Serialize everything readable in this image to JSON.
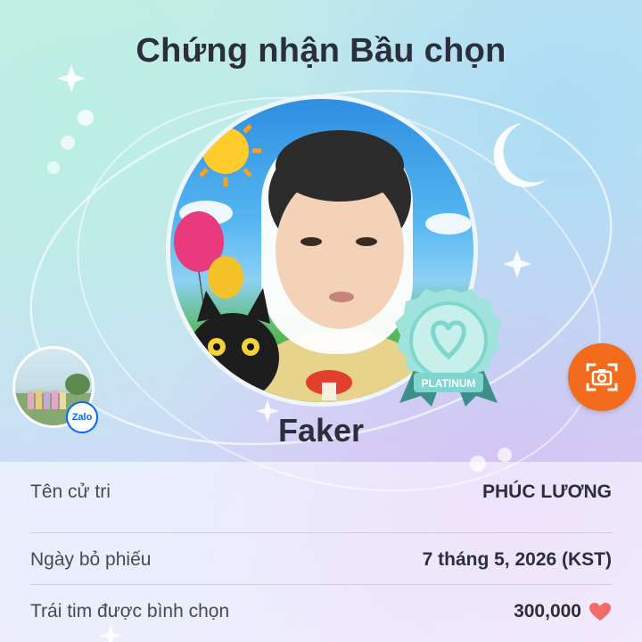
{
  "header": {
    "title": "Chứng nhận Bầu chọn"
  },
  "candidate": {
    "nickname": "Faker",
    "tier_badge": "PLATINUM"
  },
  "shortcut": {
    "app_badge": "Zalo"
  },
  "details": [
    {
      "label": "Tên cử tri",
      "value": "PHÚC LƯƠNG"
    },
    {
      "label": "Ngày bỏ phiếu",
      "value": "7 tháng 5, 2026 (KST)"
    },
    {
      "label": "Trái tim được bình chọn",
      "value": "300,000",
      "icon": "heart-icon"
    }
  ],
  "colors": {
    "accent": "#f36b1c",
    "heart": "#f26b6b",
    "badge_teal": "#7fd6cf",
    "zalo_blue": "#0068ff"
  },
  "icons": [
    "camera-icon",
    "heart-icon",
    "platinum-badge-icon",
    "sparkle-icon",
    "moon-icon"
  ]
}
